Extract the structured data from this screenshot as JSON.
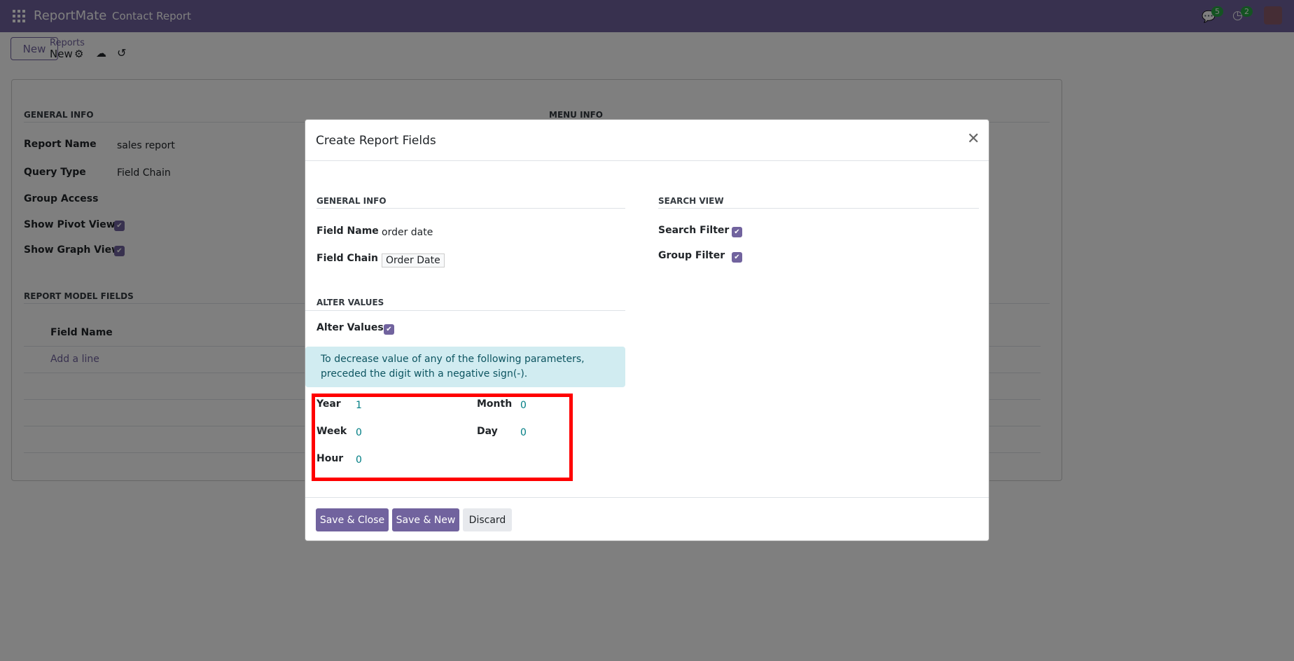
{
  "navbar": {
    "brand": "ReportMate",
    "menu": "Contact Report",
    "messages_count": "5",
    "activities_count": "2",
    "color": "#71639e"
  },
  "control_panel": {
    "new_label": "New",
    "breadcrumb_parent": "Reports",
    "breadcrumb_current": "New"
  },
  "form": {
    "general_info": "GENERAL INFO",
    "menu_info": "MENU INFO",
    "fields": [
      {
        "label": "Report Name",
        "value": "sales report"
      },
      {
        "label": "Query Type",
        "value": "Field Chain"
      },
      {
        "label": "Group Access",
        "value": ""
      },
      {
        "label": "Show Pivot View",
        "checked": true
      },
      {
        "label": "Show Graph View",
        "checked": true
      }
    ],
    "report_model_fields": "REPORT MODEL FIELDS",
    "table_header": "Field Name",
    "add_line": "Add a line"
  },
  "modal": {
    "title": "Create Report Fields",
    "general_info": "GENERAL INFO",
    "field_name_label": "Field Name",
    "field_name_value": "order date",
    "field_chain_label": "Field Chain",
    "field_chain_value": "Order Date",
    "search_view": "SEARCH VIEW",
    "search_filter_label": "Search Filter",
    "search_filter_checked": true,
    "group_filter_label": "Group Filter",
    "group_filter_checked": true,
    "alter_values_heading": "ALTER VALUES",
    "alter_values_label": "Alter Values",
    "alter_values_checked": true,
    "alert": "To decrease value of any of the following parameters, preceded the digit with a negative sign(-).",
    "year_label": "Year",
    "year": "1",
    "month_label": "Month",
    "month": "0",
    "week_label": "Week",
    "week": "0",
    "day_label": "Day",
    "day": "0",
    "hour_label": "Hour",
    "hour": "0",
    "save_close": "Save & Close",
    "save_new": "Save & New",
    "discard": "Discard"
  }
}
